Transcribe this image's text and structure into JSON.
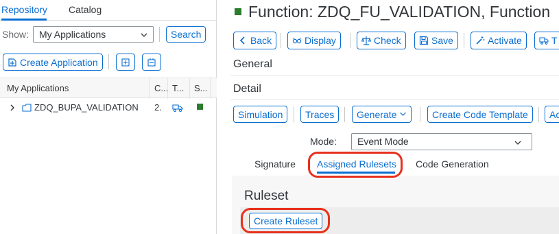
{
  "left": {
    "tabs": [
      "Repository",
      "Catalog"
    ],
    "show_label": "Show:",
    "show_value": "My Applications",
    "search_button": "Search",
    "create_application_button": "Create Application",
    "table": {
      "columns": [
        "My Applications",
        "C...",
        "T...",
        "S..."
      ],
      "rows": [
        {
          "name": "ZDQ_BUPA_VALIDATION",
          "c": "2.",
          "status_color": "#2b7d2b"
        }
      ]
    }
  },
  "right": {
    "title": "Function: ZDQ_FU_VALIDATION, Function",
    "title_status_color": "#2b7d2b",
    "toolbar": {
      "back": "Back",
      "display": "Display",
      "check": "Check",
      "save": "Save",
      "activate": "Activate",
      "truncated": "T"
    },
    "general": "General",
    "detail": "Detail",
    "detail_toolbar": {
      "simulation": "Simulation",
      "traces": "Traces",
      "generate": "Generate",
      "create_code_template": "Create Code Template",
      "truncated": "Ac"
    },
    "mode_label": "Mode:",
    "mode_value": "Event Mode",
    "subtabs": [
      "Signature",
      "Assigned Rulesets",
      "Code Generation"
    ],
    "ruleset_title": "Ruleset",
    "create_ruleset_button": "Create Ruleset"
  },
  "colors": {
    "accent": "#0a6ed1",
    "highlight": "#e8301c",
    "status_green": "#2b7d2b"
  }
}
